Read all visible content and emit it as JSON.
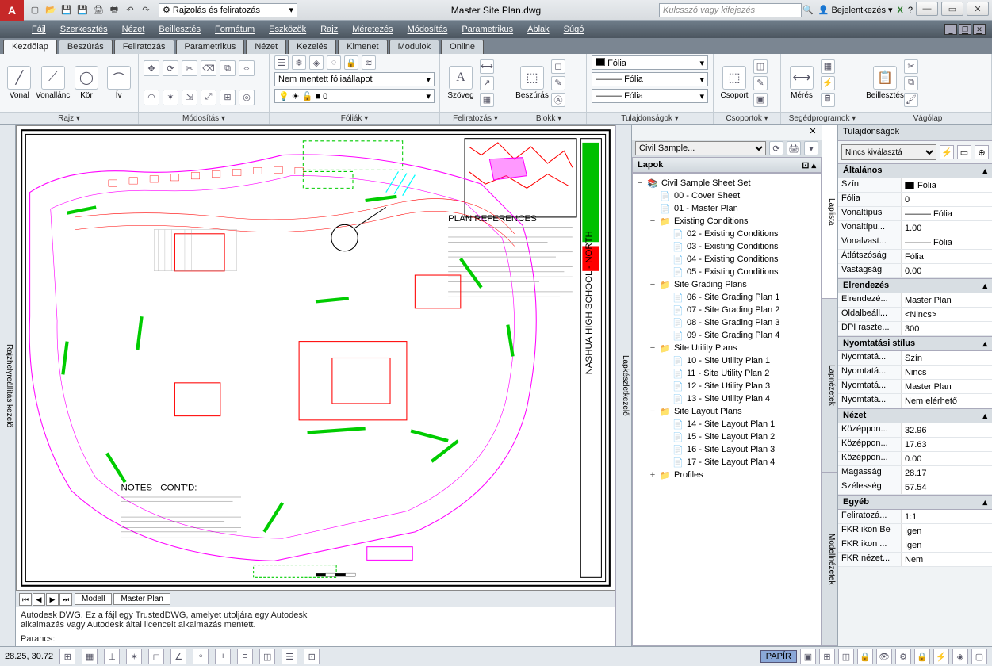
{
  "title": "Master Site Plan.dwg",
  "workspace": "Rajzolás és feliratozás",
  "search_placeholder": "Kulcsszó vagy kifejezés",
  "login": "Bejelentkezés",
  "menubar": [
    "Fájl",
    "Szerkesztés",
    "Nézet",
    "Beillesztés",
    "Formátum",
    "Eszközök",
    "Rajz",
    "Méretezés",
    "Módosítás",
    "Parametrikus",
    "Ablak",
    "Súgó"
  ],
  "ribbon_tabs": [
    "Kezdőlap",
    "Beszúrás",
    "Feliratozás",
    "Parametrikus",
    "Nézet",
    "Kezelés",
    "Kimenet",
    "Modulok",
    "Online"
  ],
  "ribbon_panels": {
    "draw": {
      "label": "Rajz ▾",
      "items": [
        "Vonal",
        "Vonallánc",
        "Kör",
        "Ív"
      ]
    },
    "modify": {
      "label": "Módosítás ▾"
    },
    "layers": {
      "label": "Fóliák ▾",
      "state": "Nem mentett fóliaállapot"
    },
    "text": {
      "label": "Feliratozás ▾",
      "item": "Szöveg"
    },
    "block": {
      "label": "Blokk ▾",
      "item": "Beszúrás"
    },
    "properties": {
      "label": "Tulajdonságok ▾",
      "layer": "Fólia",
      "linetype": "Fólia",
      "lineweight": "Fólia"
    },
    "groups": {
      "label": "Csoportok ▾",
      "item": "Csoport"
    },
    "utilities": {
      "label": "Segédprogramok ▾",
      "item": "Mérés"
    },
    "clipboard": {
      "label": "Vágólap",
      "item": "Beillesztés"
    }
  },
  "sheet_set": {
    "selector": "Civil Sample...",
    "group": "Lapok",
    "root": "Civil Sample Sheet Set",
    "items": [
      {
        "indent": 1,
        "icon": "sheet",
        "text": "00 - Cover Sheet"
      },
      {
        "indent": 1,
        "icon": "sheet",
        "text": "01 - Master Plan"
      },
      {
        "indent": 1,
        "icon": "folder",
        "text": "Existing Conditions",
        "exp": "−"
      },
      {
        "indent": 2,
        "icon": "sheet",
        "text": "02 - Existing Conditions"
      },
      {
        "indent": 2,
        "icon": "sheet",
        "text": "03 - Existing Conditions"
      },
      {
        "indent": 2,
        "icon": "sheet",
        "text": "04 - Existing Conditions"
      },
      {
        "indent": 2,
        "icon": "sheet",
        "text": "05 - Existing Conditions"
      },
      {
        "indent": 1,
        "icon": "folder",
        "text": "Site Grading Plans",
        "exp": "−"
      },
      {
        "indent": 2,
        "icon": "sheet",
        "text": "06 - Site Grading Plan 1"
      },
      {
        "indent": 2,
        "icon": "sheet",
        "text": "07 - Site Grading Plan 2"
      },
      {
        "indent": 2,
        "icon": "sheet",
        "text": "08 - Site Grading Plan 3"
      },
      {
        "indent": 2,
        "icon": "sheet",
        "text": "09 - Site Grading Plan 4"
      },
      {
        "indent": 1,
        "icon": "folder",
        "text": "Site Utility Plans",
        "exp": "−"
      },
      {
        "indent": 2,
        "icon": "sheet",
        "text": "10 - Site Utility Plan 1"
      },
      {
        "indent": 2,
        "icon": "sheet",
        "text": "11 - Site Utility Plan 2"
      },
      {
        "indent": 2,
        "icon": "sheet",
        "text": "12 - Site Utility Plan 3"
      },
      {
        "indent": 2,
        "icon": "sheet",
        "text": "13 - Site Utility Plan 4"
      },
      {
        "indent": 1,
        "icon": "folder",
        "text": "Site Layout Plans",
        "exp": "−"
      },
      {
        "indent": 2,
        "icon": "sheet",
        "text": "14 - Site Layout Plan 1"
      },
      {
        "indent": 2,
        "icon": "sheet",
        "text": "15 - Site Layout Plan 2"
      },
      {
        "indent": 2,
        "icon": "sheet",
        "text": "16 - Site Layout Plan 3"
      },
      {
        "indent": 2,
        "icon": "sheet",
        "text": "17 - Site Layout Plan 4"
      },
      {
        "indent": 1,
        "icon": "folder",
        "text": "Profiles",
        "exp": "+"
      }
    ],
    "vtabs": [
      "Laplista",
      "Lapnézetek",
      "Modellnézetek"
    ],
    "side_tab": "Lapkészletkezelő"
  },
  "properties": {
    "title": "Tulajdonságok",
    "selector": "Nincs kiválasztá",
    "groups": [
      {
        "name": "Általános",
        "rows": [
          {
            "k": "Szín",
            "v": "Fólia",
            "swatch": true
          },
          {
            "k": "Fólia",
            "v": "0"
          },
          {
            "k": "Vonaltípus",
            "v": "——— Fólia"
          },
          {
            "k": "Vonaltípu...",
            "v": "1.00"
          },
          {
            "k": "Vonalvast...",
            "v": "——— Fólia"
          },
          {
            "k": "Átlátszóság",
            "v": "Fólia"
          },
          {
            "k": "Vastagság",
            "v": "0.00"
          }
        ]
      },
      {
        "name": "Elrendezés",
        "rows": [
          {
            "k": "Elrendezé...",
            "v": "Master Plan"
          },
          {
            "k": "Oldalbeáll...",
            "v": "<Nincs>"
          },
          {
            "k": "DPI raszte...",
            "v": "300"
          }
        ]
      },
      {
        "name": "Nyomtatási stílus",
        "rows": [
          {
            "k": "Nyomtatá...",
            "v": "Szín"
          },
          {
            "k": "Nyomtatá...",
            "v": "Nincs"
          },
          {
            "k": "Nyomtatá...",
            "v": "Master Plan"
          },
          {
            "k": "Nyomtatá...",
            "v": "Nem elérhető"
          }
        ]
      },
      {
        "name": "Nézet",
        "rows": [
          {
            "k": "Középpon...",
            "v": "32.96"
          },
          {
            "k": "Középpon...",
            "v": "17.63"
          },
          {
            "k": "Középpon...",
            "v": "0.00"
          },
          {
            "k": "Magasság",
            "v": "28.17"
          },
          {
            "k": "Szélesség",
            "v": "57.54"
          }
        ]
      },
      {
        "name": "Egyéb",
        "rows": [
          {
            "k": "Feliratozá...",
            "v": "1:1"
          },
          {
            "k": "FKR ikon Be",
            "v": "Igen"
          },
          {
            "k": "FKR ikon ...",
            "v": "Igen"
          },
          {
            "k": "FKR nézet...",
            "v": "Nem"
          }
        ]
      }
    ]
  },
  "model_tabs": [
    "Modell",
    "Master Plan"
  ],
  "cmdline": {
    "line1": "Autodesk DWG. Ez a fájl egy TrustedDWG, amelyet utoljára egy Autodesk",
    "line2": "alkalmazás vagy Autodesk által licencelt alkalmazás mentett.",
    "prompt": "Parancs:"
  },
  "status": {
    "coords": "28.25, 30.72",
    "paper": "PAPÍR"
  },
  "left_rail": "Rajzhelyreállítás kezelő"
}
